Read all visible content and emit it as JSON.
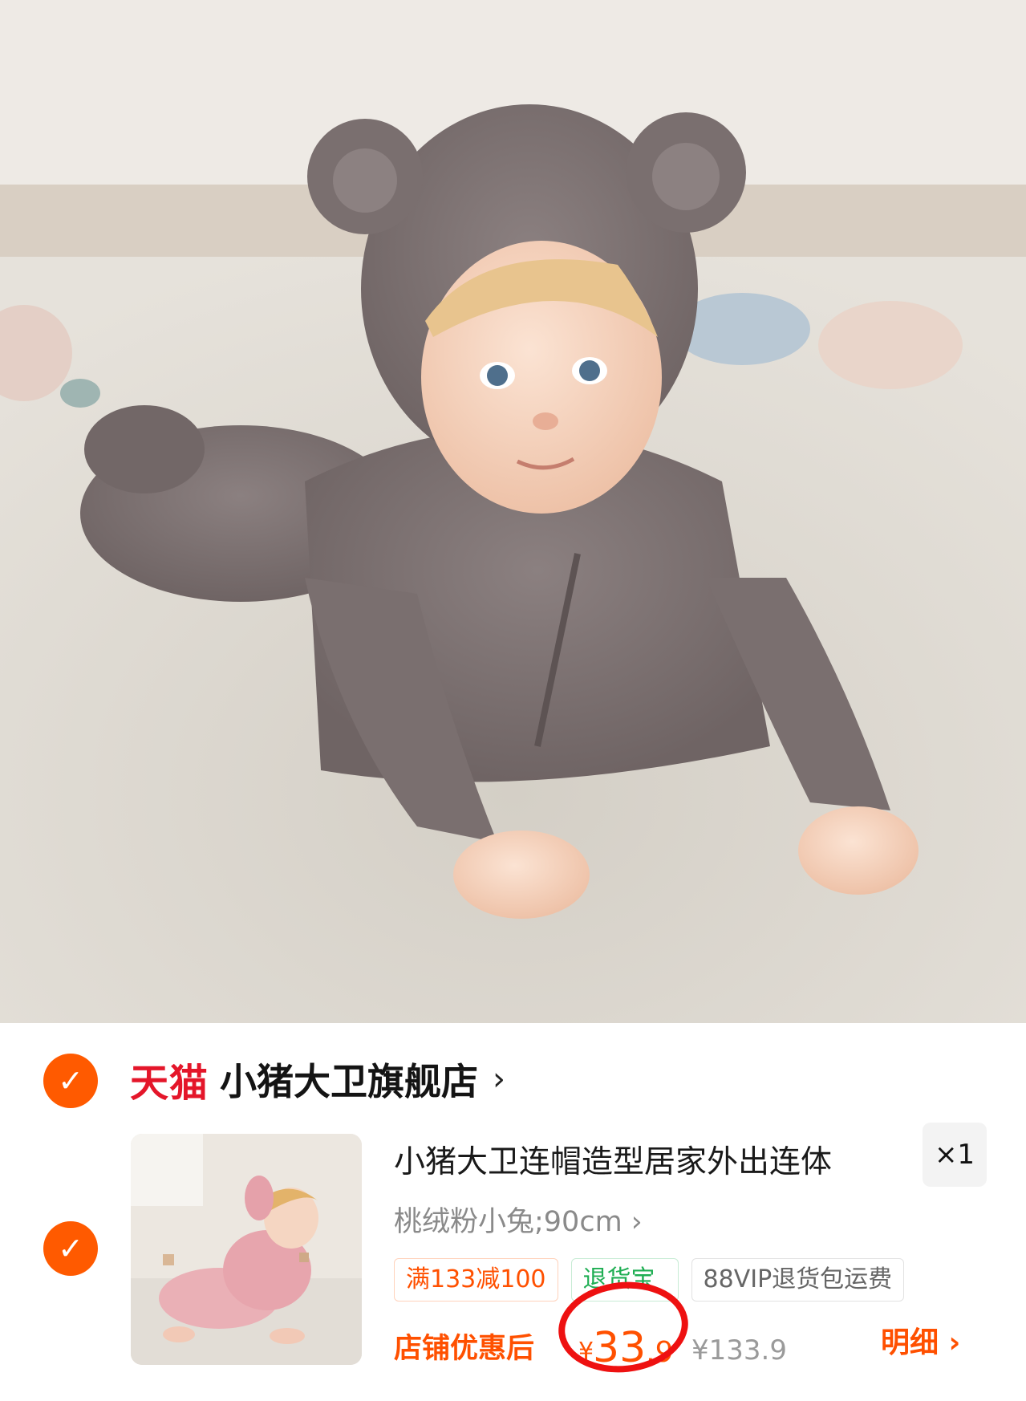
{
  "hero": {
    "image_subject": "baby-in-bear-hoodie-onesie"
  },
  "shop": {
    "platform_logo": "天猫",
    "name": "小猪大卫旗舰店",
    "chevron": "›"
  },
  "item": {
    "title": "小猪大卫连帽造型居家外出连体",
    "quantity": "×1",
    "sku": "桃绒粉小兔;90cm ›",
    "tags": [
      "满133减100",
      "退货宝",
      "88VIP退货包运费"
    ],
    "price_label": "店铺优惠后",
    "currency": "¥",
    "price_int": "33",
    "price_dec": ".9",
    "original_price": "¥133.9",
    "detail_link": "明细 ›"
  },
  "colors": {
    "accent": "#ff5000",
    "check": "#ff5a00",
    "tmall_red": "#e4162a",
    "annotation_red": "#ee1111",
    "tag_green": "#1fae53"
  },
  "icons": {
    "check": "✓"
  }
}
